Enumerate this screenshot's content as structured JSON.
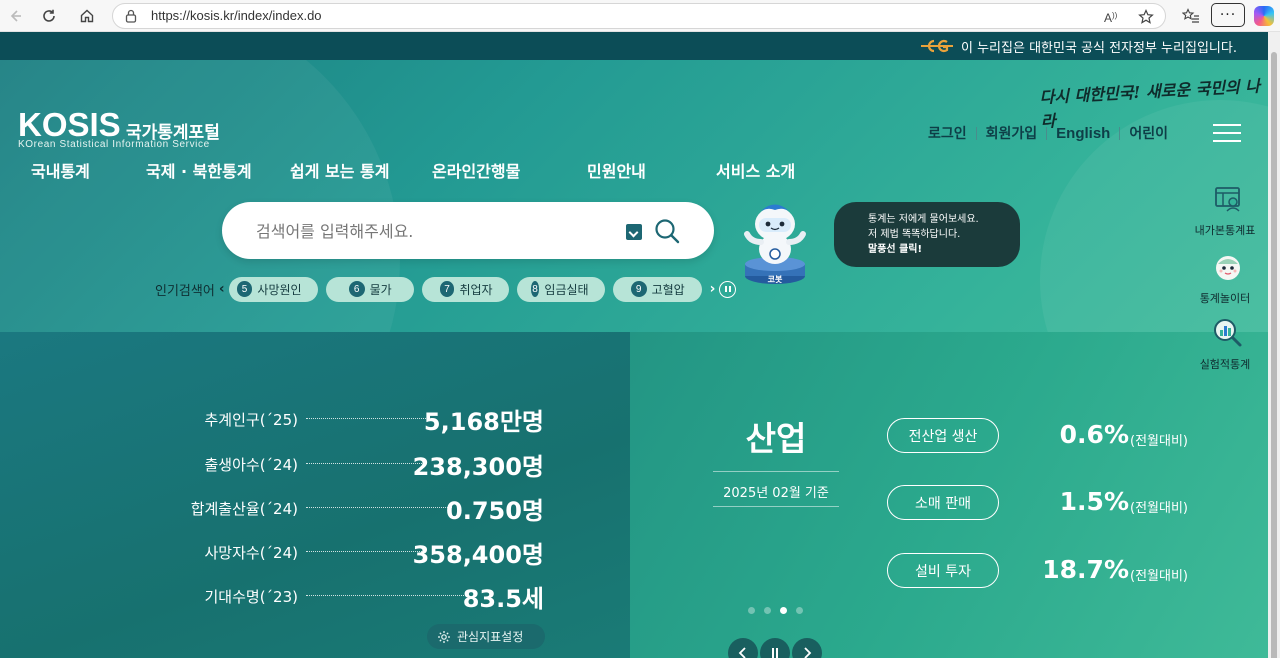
{
  "browser": {
    "url": "https://kosis.kr/index/index.do",
    "more_label": "···"
  },
  "gov_banner": {
    "text": "이 누리집은 대한민국 공식 전자정부 누리집입니다."
  },
  "header": {
    "slogan": "다시 대한민국! 새로운 국민의 나라",
    "logo_text": "KOSIS",
    "logo_kr": "국가통계포털",
    "logo_en": "KOrean Statistical Information Service",
    "utility_links": [
      "로그인",
      "회원가입",
      "English",
      "어린이"
    ]
  },
  "gnb": [
    "국내통계",
    "국제 · 북한통계",
    "쉽게 보는 통계",
    "온라인간행물",
    "민원안내",
    "서비스 소개"
  ],
  "search": {
    "placeholder": "검색어를 입력해주세요."
  },
  "mascot": {
    "name": "코봇",
    "bubble": [
      "통계는 저에게 물어보세요.",
      "저 제법 똑똑하답니다.",
      "말풍선 클릭!"
    ]
  },
  "popular": {
    "label": "인기검색어",
    "items": [
      {
        "rank": "5",
        "text": "사망원인"
      },
      {
        "rank": "6",
        "text": "물가"
      },
      {
        "rank": "7",
        "text": "취업자"
      },
      {
        "rank": "8",
        "text": "임금실태"
      },
      {
        "rank": "9",
        "text": "고혈압"
      }
    ]
  },
  "quick_menu": [
    {
      "label": "내가본통계표",
      "icon": "table-icon"
    },
    {
      "label": "통계놀이터",
      "icon": "character-icon"
    },
    {
      "label": "실험적통계",
      "icon": "magnifier-chart-icon"
    }
  ],
  "key_stats": [
    {
      "name": "추계인구(´25)",
      "value": "5,168만명"
    },
    {
      "name": "출생아수(´24)",
      "value": "238,300명"
    },
    {
      "name": "합계출산율(´24)",
      "value": "0.750명"
    },
    {
      "name": "사망자수(´24)",
      "value": "358,400명"
    },
    {
      "name": "기대수명(´23)",
      "value": "83.5세"
    }
  ],
  "settings_button": "관심지표설정",
  "industry": {
    "title": "산업",
    "date": "2025년 02월 기준",
    "rows": [
      {
        "label": "전산업 생산",
        "value": "0.6%",
        "note": "(전월대비)"
      },
      {
        "label": "소매 판매",
        "value": "1.5%",
        "note": "(전월대비)"
      },
      {
        "label": "설비 투자",
        "value": "18.7%",
        "note": "(전월대비)"
      }
    ],
    "active_slide": 3,
    "total_slides": 4
  },
  "colors": {
    "gov_banner": "#0c4d57",
    "accent": "#1d6773",
    "teal_start": "#1c7f82",
    "teal_end": "#4cc29f"
  }
}
